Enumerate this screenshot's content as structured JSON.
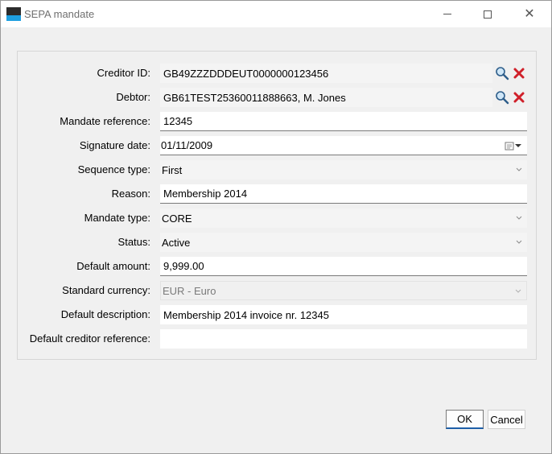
{
  "window": {
    "title": "SEPA mandate"
  },
  "form": {
    "creditor_id": {
      "label": "Creditor ID:",
      "value": "GB49ZZZDDDEUT0000000123456"
    },
    "debtor": {
      "label": "Debtor:",
      "value": "GB61TEST25360011888663, M. Jones"
    },
    "mandate_reference": {
      "label": "Mandate reference:",
      "value": "12345"
    },
    "signature_date": {
      "label": "Signature date:",
      "value": "01/11/2009"
    },
    "sequence_type": {
      "label": "Sequence type:",
      "value": "First"
    },
    "reason": {
      "label": "Reason:",
      "value": "Membership 2014"
    },
    "mandate_type": {
      "label": "Mandate type:",
      "value": "CORE"
    },
    "status": {
      "label": "Status:",
      "value": "Active"
    },
    "default_amount": {
      "label": "Default amount:",
      "value": "9,999.00"
    },
    "standard_currency": {
      "label": "Standard currency:",
      "value": "EUR - Euro"
    },
    "default_description": {
      "label": "Default description:",
      "value": "Membership 2014 invoice nr. 12345"
    },
    "default_creditor_reference": {
      "label": "Default creditor reference:",
      "value": ""
    }
  },
  "buttons": {
    "ok": "OK",
    "cancel": "Cancel"
  },
  "icons": {
    "lookup": "magnifier-icon",
    "clear": "red-x-icon",
    "calendar": "calendar-icon"
  },
  "colors": {
    "accent": "#1e9fe0",
    "clear_red": "#d0202a",
    "focus_border": "#1e5fa8"
  }
}
